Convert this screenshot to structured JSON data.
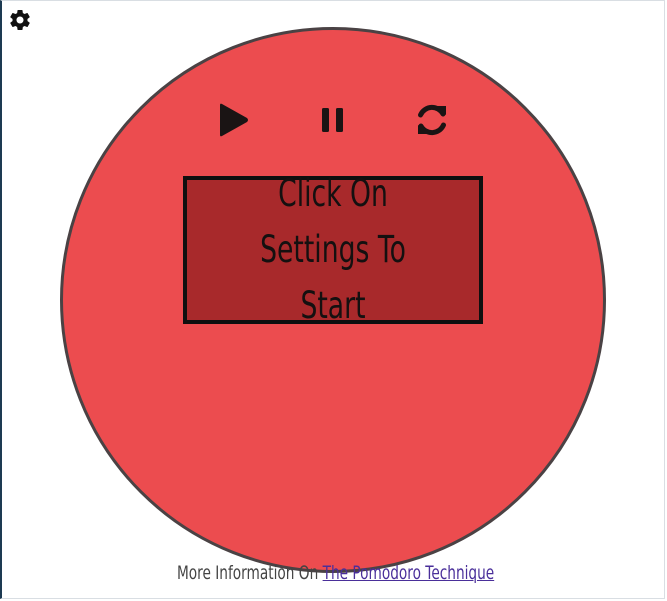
{
  "app": {
    "settings_icon": "gear-icon"
  },
  "controls": {
    "play_icon": "play-icon",
    "pause_icon": "pause-icon",
    "reset_icon": "refresh-icon"
  },
  "timer": {
    "message": "Click On Settings To Start"
  },
  "footer": {
    "prefix": "More Information On ",
    "link_text": "The Pomodoro Technique"
  },
  "colors": {
    "circle": "#ec4c4f",
    "display": "#a8292b",
    "border": "#4a4244",
    "link": "#4a2f9a"
  }
}
